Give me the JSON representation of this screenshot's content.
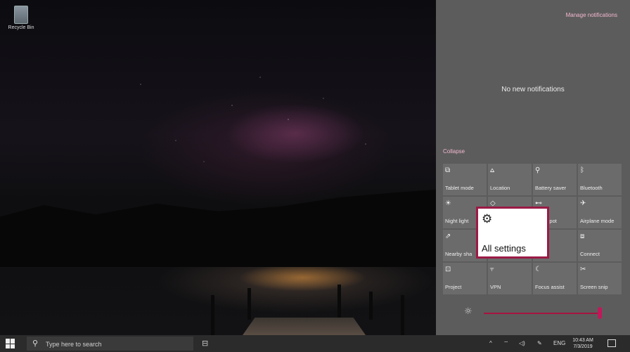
{
  "desktop": {
    "recycle_bin_label": "Recycle Bin"
  },
  "action_center": {
    "manage_notifications": "Manage notifications",
    "no_notifications": "No new notifications",
    "collapse": "Collapse",
    "tiles": [
      {
        "label": "Tablet mode",
        "icon": "tablet-mode-icon",
        "glyph": "⧉"
      },
      {
        "label": "Location",
        "icon": "location-icon",
        "glyph": "⩟"
      },
      {
        "label": "Battery saver",
        "icon": "battery-saver-icon",
        "glyph": "⚲"
      },
      {
        "label": "Bluetooth",
        "icon": "bluetooth-icon",
        "glyph": "ᛒ"
      },
      {
        "label": "Night light",
        "icon": "night-light-icon",
        "glyph": "☀"
      },
      {
        "label": "",
        "icon": "hidden-tile-icon",
        "glyph": "◇"
      },
      {
        "label": "e hotspot",
        "icon": "mobile-hotspot-icon",
        "glyph": "⊷"
      },
      {
        "label": "Airplane mode",
        "icon": "airplane-mode-icon",
        "glyph": "✈"
      },
      {
        "label": "Nearby sha",
        "icon": "nearby-sharing-icon",
        "glyph": "⇗"
      },
      {
        "label": "",
        "icon": "hidden-tile-icon",
        "glyph": ""
      },
      {
        "label": "ork",
        "icon": "network-icon",
        "glyph": ""
      },
      {
        "label": "Connect",
        "icon": "connect-icon",
        "glyph": "⧈"
      },
      {
        "label": "Project",
        "icon": "project-icon",
        "glyph": "⊡"
      },
      {
        "label": "VPN",
        "icon": "vpn-icon",
        "glyph": "⫧"
      },
      {
        "label": "Focus assist",
        "icon": "focus-assist-icon",
        "glyph": "☾"
      },
      {
        "label": "Screen snip",
        "icon": "screen-snip-icon",
        "glyph": "✂"
      }
    ],
    "brightness_level": 0.98
  },
  "callout": {
    "label": "All settings",
    "icon": "gear-icon",
    "glyph": "⚙"
  },
  "taskbar": {
    "search_placeholder": "Type here to search",
    "language": "ENG",
    "time": "10:43 AM",
    "date": "7/3/2019",
    "tray_glyphs": {
      "chevron": "^",
      "network": "⌔",
      "volume": "◁)",
      "pen": "✎"
    }
  },
  "colors": {
    "accent": "#c2185b",
    "link": "#f2b7cf",
    "panel": "#5c5c5c",
    "tile": "#6b6b6b",
    "taskbar": "#2b2b2b"
  }
}
